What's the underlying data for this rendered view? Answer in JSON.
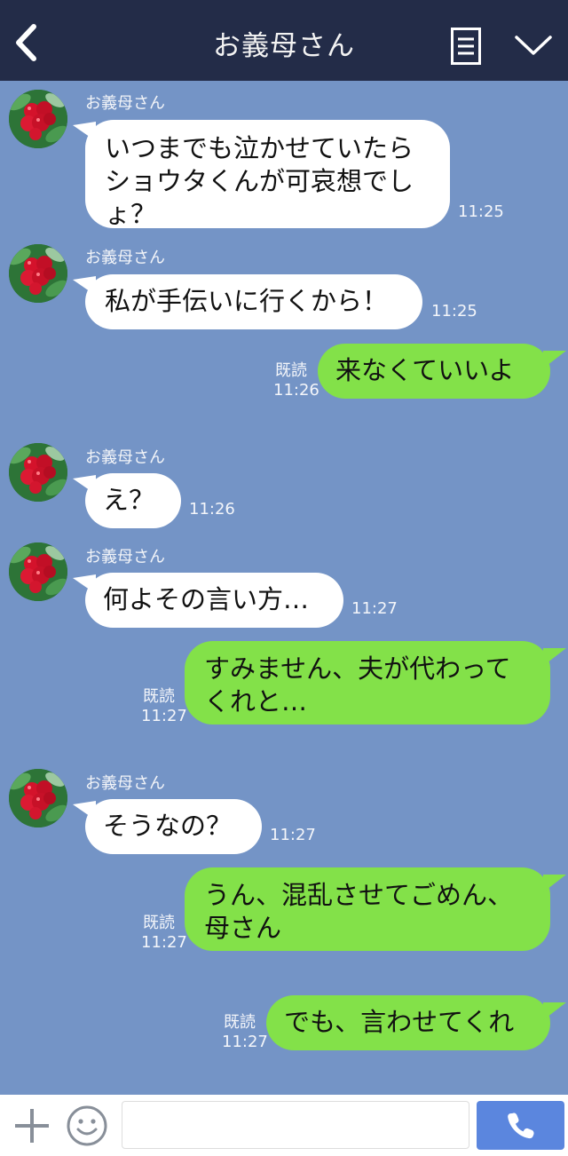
{
  "header": {
    "title": "お義母さん",
    "back_icon": "chevron-left-icon",
    "menu_icon": "menu-icon",
    "collapse_icon": "chevron-down-icon"
  },
  "colors": {
    "header_bg": "#232c48",
    "chat_bg": "#7494c6",
    "incoming_bubble": "#ffffff",
    "outgoing_bubble": "#83e149",
    "send_button": "#5b86de"
  },
  "messages": [
    {
      "side": "in",
      "sender": "お義母さん",
      "text": "いつまでも泣かせていたら\nショウタくんが可哀想でし\nょ？",
      "time": "11:25"
    },
    {
      "side": "in",
      "sender": "お義母さん",
      "text": "私が手伝いに行くから！",
      "time": "11:25"
    },
    {
      "side": "out",
      "read": "既読",
      "text": "来なくていいよ",
      "time": "11:26"
    },
    {
      "side": "in",
      "sender": "お義母さん",
      "text": "え？",
      "time": "11:26"
    },
    {
      "side": "in",
      "sender": "お義母さん",
      "text": "何よその言い方…",
      "time": "11:27"
    },
    {
      "side": "out",
      "read": "既読",
      "text": "すみません、夫が代わって\nくれと…",
      "time": "11:27"
    },
    {
      "side": "in",
      "sender": "お義母さん",
      "text": "そうなの？",
      "time": "11:27"
    },
    {
      "side": "out",
      "read": "既読",
      "text": "うん、混乱させてごめん、\n母さん",
      "time": "11:27"
    },
    {
      "side": "out",
      "read": "既読",
      "text": "でも、言わせてくれ",
      "time": "11:27"
    }
  ],
  "footer": {
    "plus_icon": "plus-icon",
    "emoji_icon": "smile-icon",
    "input_value": "",
    "send_icon": "phone-icon"
  }
}
